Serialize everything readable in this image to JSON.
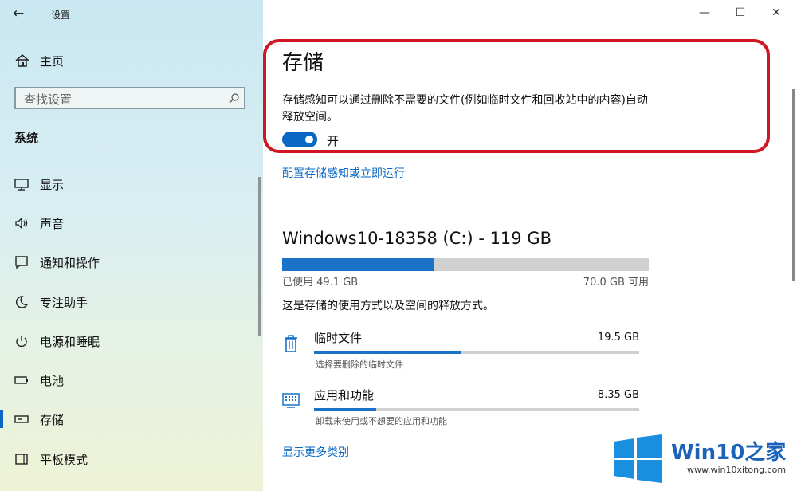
{
  "titlebar": {
    "app_title": "设置"
  },
  "sidebar": {
    "home_label": "主页",
    "search_placeholder": "查找设置",
    "section_title": "系统",
    "items": [
      {
        "label": "显示",
        "icon": "monitor-icon",
        "selected": false
      },
      {
        "label": "声音",
        "icon": "speaker-icon",
        "selected": false
      },
      {
        "label": "通知和操作",
        "icon": "notification-icon",
        "selected": false
      },
      {
        "label": "专注助手",
        "icon": "moon-icon",
        "selected": false
      },
      {
        "label": "电源和睡眠",
        "icon": "power-icon",
        "selected": false
      },
      {
        "label": "电池",
        "icon": "battery-icon",
        "selected": false
      },
      {
        "label": "存储",
        "icon": "storage-icon",
        "selected": true
      },
      {
        "label": "平板模式",
        "icon": "tablet-icon",
        "selected": false
      }
    ]
  },
  "main": {
    "title": "存储",
    "description": "存储感知可以通过删除不需要的文件(例如临时文件和回收站中的内容)自动释放空间。",
    "toggle_state": "开",
    "configure_link": "配置存储感知或立即运行",
    "drive": {
      "title": "Windows10-18358 (C:) - 119 GB",
      "used": "已使用 49.1 GB",
      "free": "70.0 GB 可用",
      "used_fraction": 0.413
    },
    "usage_explain": "这是存储的使用方式以及空间的释放方式。",
    "categories": [
      {
        "name": "临时文件",
        "size": "19.5 GB",
        "subtitle": "选择要删除的临时文件",
        "fraction": 0.45,
        "icon": "trash-icon"
      },
      {
        "name": "应用和功能",
        "size": "8.35 GB",
        "subtitle": "卸载未使用或不想要的应用和功能",
        "fraction": 0.19,
        "icon": "keyboard-icon"
      }
    ],
    "more_link": "显示更多类别"
  },
  "watermark": {
    "brand": "Win10之家",
    "url": "www.win10xitong.com"
  },
  "colors": {
    "accent": "#0a67c4",
    "highlight_border": "#d01622",
    "bar_fill": "#1a73c8"
  }
}
